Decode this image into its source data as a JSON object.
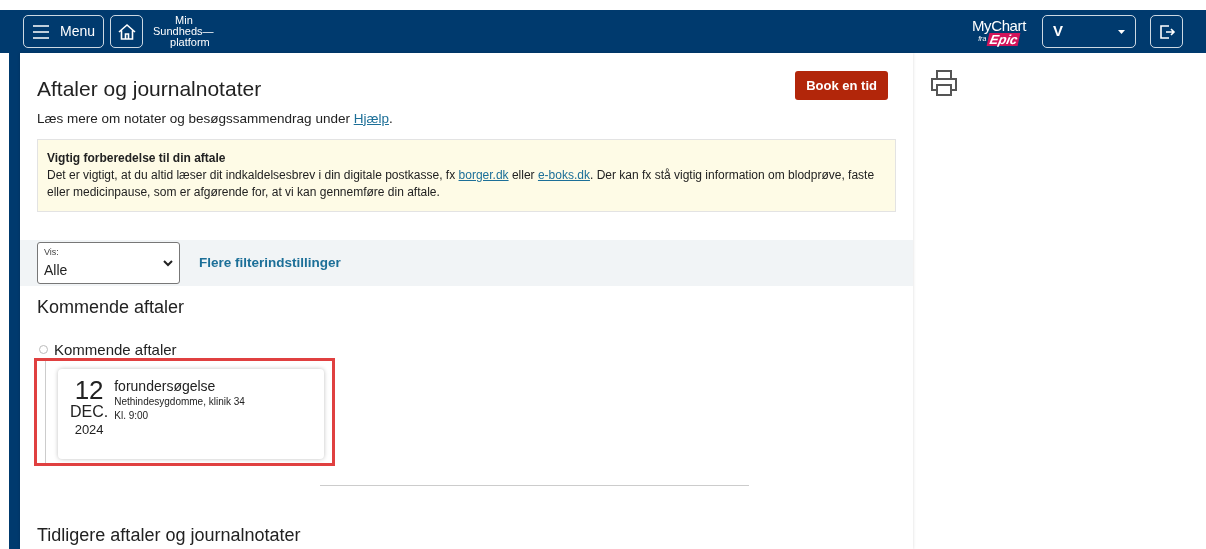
{
  "header": {
    "menu_button": "Menu",
    "brand": [
      "Min",
      "Sundheds—",
      "platform"
    ],
    "logo": {
      "name": "MyChart",
      "sub": "fra",
      "brand": "Epic"
    },
    "account": "V"
  },
  "page": {
    "title": "Aftaler og journalnotater",
    "book_button": "Book en tid",
    "intro": [
      {
        "kind": "text",
        "text": "Læs mere om notater og besøgssammendrag under "
      },
      {
        "kind": "link",
        "text": "Hjælp"
      },
      {
        "kind": "text",
        "text": "."
      }
    ],
    "notice": {
      "title": "Vigtig forberedelse til din aftale",
      "body": [
        {
          "kind": "text",
          "text": "Det er vigtigt, at du altid læser dit indkaldelsesbrev i din digitale postkasse, fx "
        },
        {
          "kind": "link",
          "text": "borger.dk"
        },
        {
          "kind": "text",
          "text": " eller "
        },
        {
          "kind": "link",
          "text": "e-boks.dk"
        },
        {
          "kind": "text",
          "text": ". Der kan fx stå vigtig information om blodprøve, faste eller medicinpause, som er afgørende for, at vi kan gennemføre din aftale."
        }
      ]
    },
    "filter": {
      "label": "Vis:",
      "value": "Alle",
      "more": "Flere filterindstillinger"
    },
    "upcoming": {
      "heading": "Kommende aftaler",
      "group": "Kommende aftaler",
      "highlighted": true,
      "appointments": [
        {
          "day": "12",
          "month": "DEC.",
          "year": "2024",
          "title": "forundersøgelse",
          "place": "Nethindesygdomme, klinik 34",
          "time": "Kl. 9:00"
        }
      ]
    },
    "past_heading": "Tidligere aftaler og journalnotater"
  }
}
